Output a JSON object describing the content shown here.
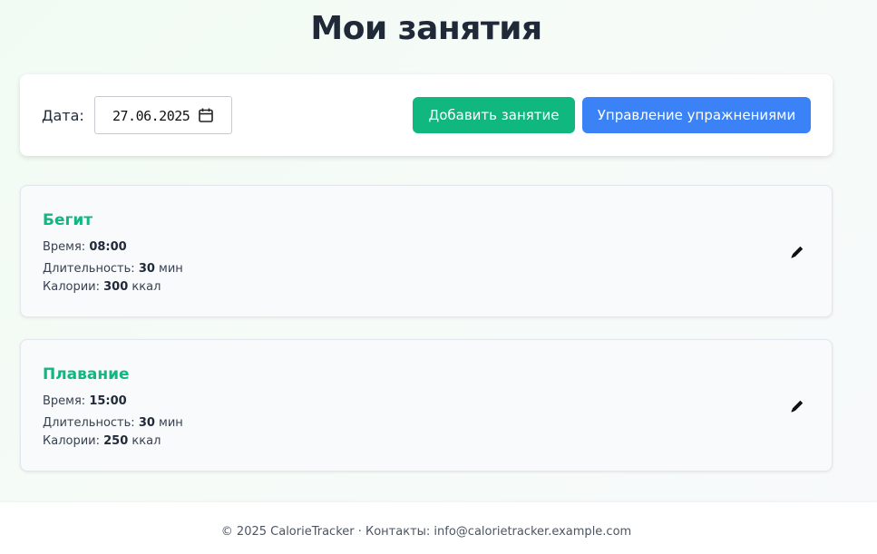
{
  "page": {
    "title": "Мои занятия"
  },
  "toolbar": {
    "date_label": "Дата:",
    "date_value": "27.06.2025",
    "add_button": "Добавить занятие",
    "manage_button": "Управление упражнениями",
    "colors": {
      "add": "#10b77f",
      "manage": "#3b82f6"
    }
  },
  "activities": [
    {
      "name": "Бегит",
      "time_label": "Время:",
      "time": "08:00",
      "duration_label": "Длительность:",
      "duration": "30",
      "duration_unit": "мин",
      "calories_label": "Калории:",
      "calories": "300",
      "calories_unit": "ккал",
      "edit_icon": "pencil-icon"
    },
    {
      "name": "Плавание",
      "time_label": "Время:",
      "time": "15:00",
      "duration_label": "Длительность:",
      "duration": "30",
      "duration_unit": "мин",
      "calories_label": "Калории:",
      "calories": "250",
      "calories_unit": "ккал",
      "edit_icon": "pencil-icon"
    }
  ],
  "footer": {
    "text": "© 2025 CalorieTracker · Контакты: info@calorietracker.example.com"
  },
  "colors": {
    "accent_green": "#10b77f",
    "accent_blue": "#3b82f6"
  }
}
